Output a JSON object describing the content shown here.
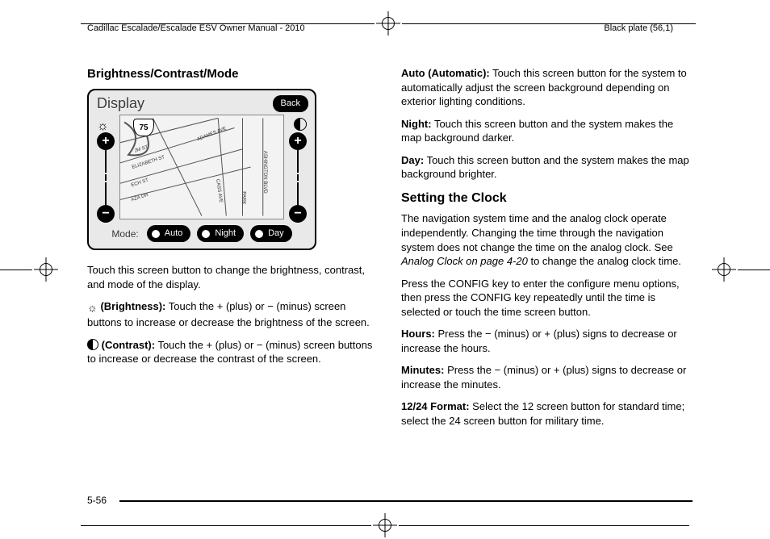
{
  "header": {
    "manual_title": "Cadillac Escalade/Escalade ESV Owner Manual - 2010",
    "plate": "Black plate (56,1)"
  },
  "page_number": "5-56",
  "left": {
    "heading": "Brightness/Contrast/Mode",
    "screen": {
      "title": "Display",
      "back": "Back",
      "plus": "+",
      "minus": "−",
      "route": "75",
      "streets": {
        "a": "JM ST",
        "b": "ELIZABETH  ST",
        "c": "ECH ST",
        "d": "AZA  DR",
        "e": "ADAMES  AVE",
        "f": "CASS AVE",
        "g": "PARK",
        "h": "ASHINGTON BLVD"
      },
      "mode_label": "Mode:",
      "modes": {
        "auto": "Auto",
        "night": "Night",
        "day": "Day"
      }
    },
    "p1": "Touch this screen button to change the brightness, contrast, and mode of the display.",
    "brightness_label": "(Brightness):",
    "brightness_text": "Touch the + (plus) or − (minus) screen buttons to increase or decrease the brightness of the screen.",
    "contrast_label": "(Contrast):",
    "contrast_text": "Touch the + (plus) or − (minus) screen buttons to increase or decrease the contrast of the screen."
  },
  "right": {
    "auto_label": "Auto (Automatic):",
    "auto_text": "Touch this screen button for the system to automatically adjust the screen background depending on exterior lighting conditions.",
    "night_label": "Night:",
    "night_text": "Touch this screen button and the system makes the map background darker.",
    "day_label": "Day:",
    "day_text": "Touch this screen button and the system makes the map background brighter.",
    "heading2": "Setting the Clock",
    "clock_p1a": "The navigation system time and the analog clock operate independently. Changing the time through the navigation system does not change the time on the analog clock. See ",
    "clock_ref": "Analog Clock on page 4‑20",
    "clock_p1b": " to change the analog clock time.",
    "clock_p2": "Press the CONFIG key to enter the configure menu options, then press the CONFIG key repeatedly until the time is selected or touch the time screen button.",
    "hours_label": "Hours:",
    "hours_text": "Press the − (minus) or + (plus) signs to decrease or increase the hours.",
    "minutes_label": "Minutes:",
    "minutes_text": "Press the − (minus) or + (plus) signs to decrease or increase the minutes.",
    "format_label": "12/24 Format:",
    "format_text": "Select the 12 screen button for standard time; select the 24 screen button for military time."
  }
}
